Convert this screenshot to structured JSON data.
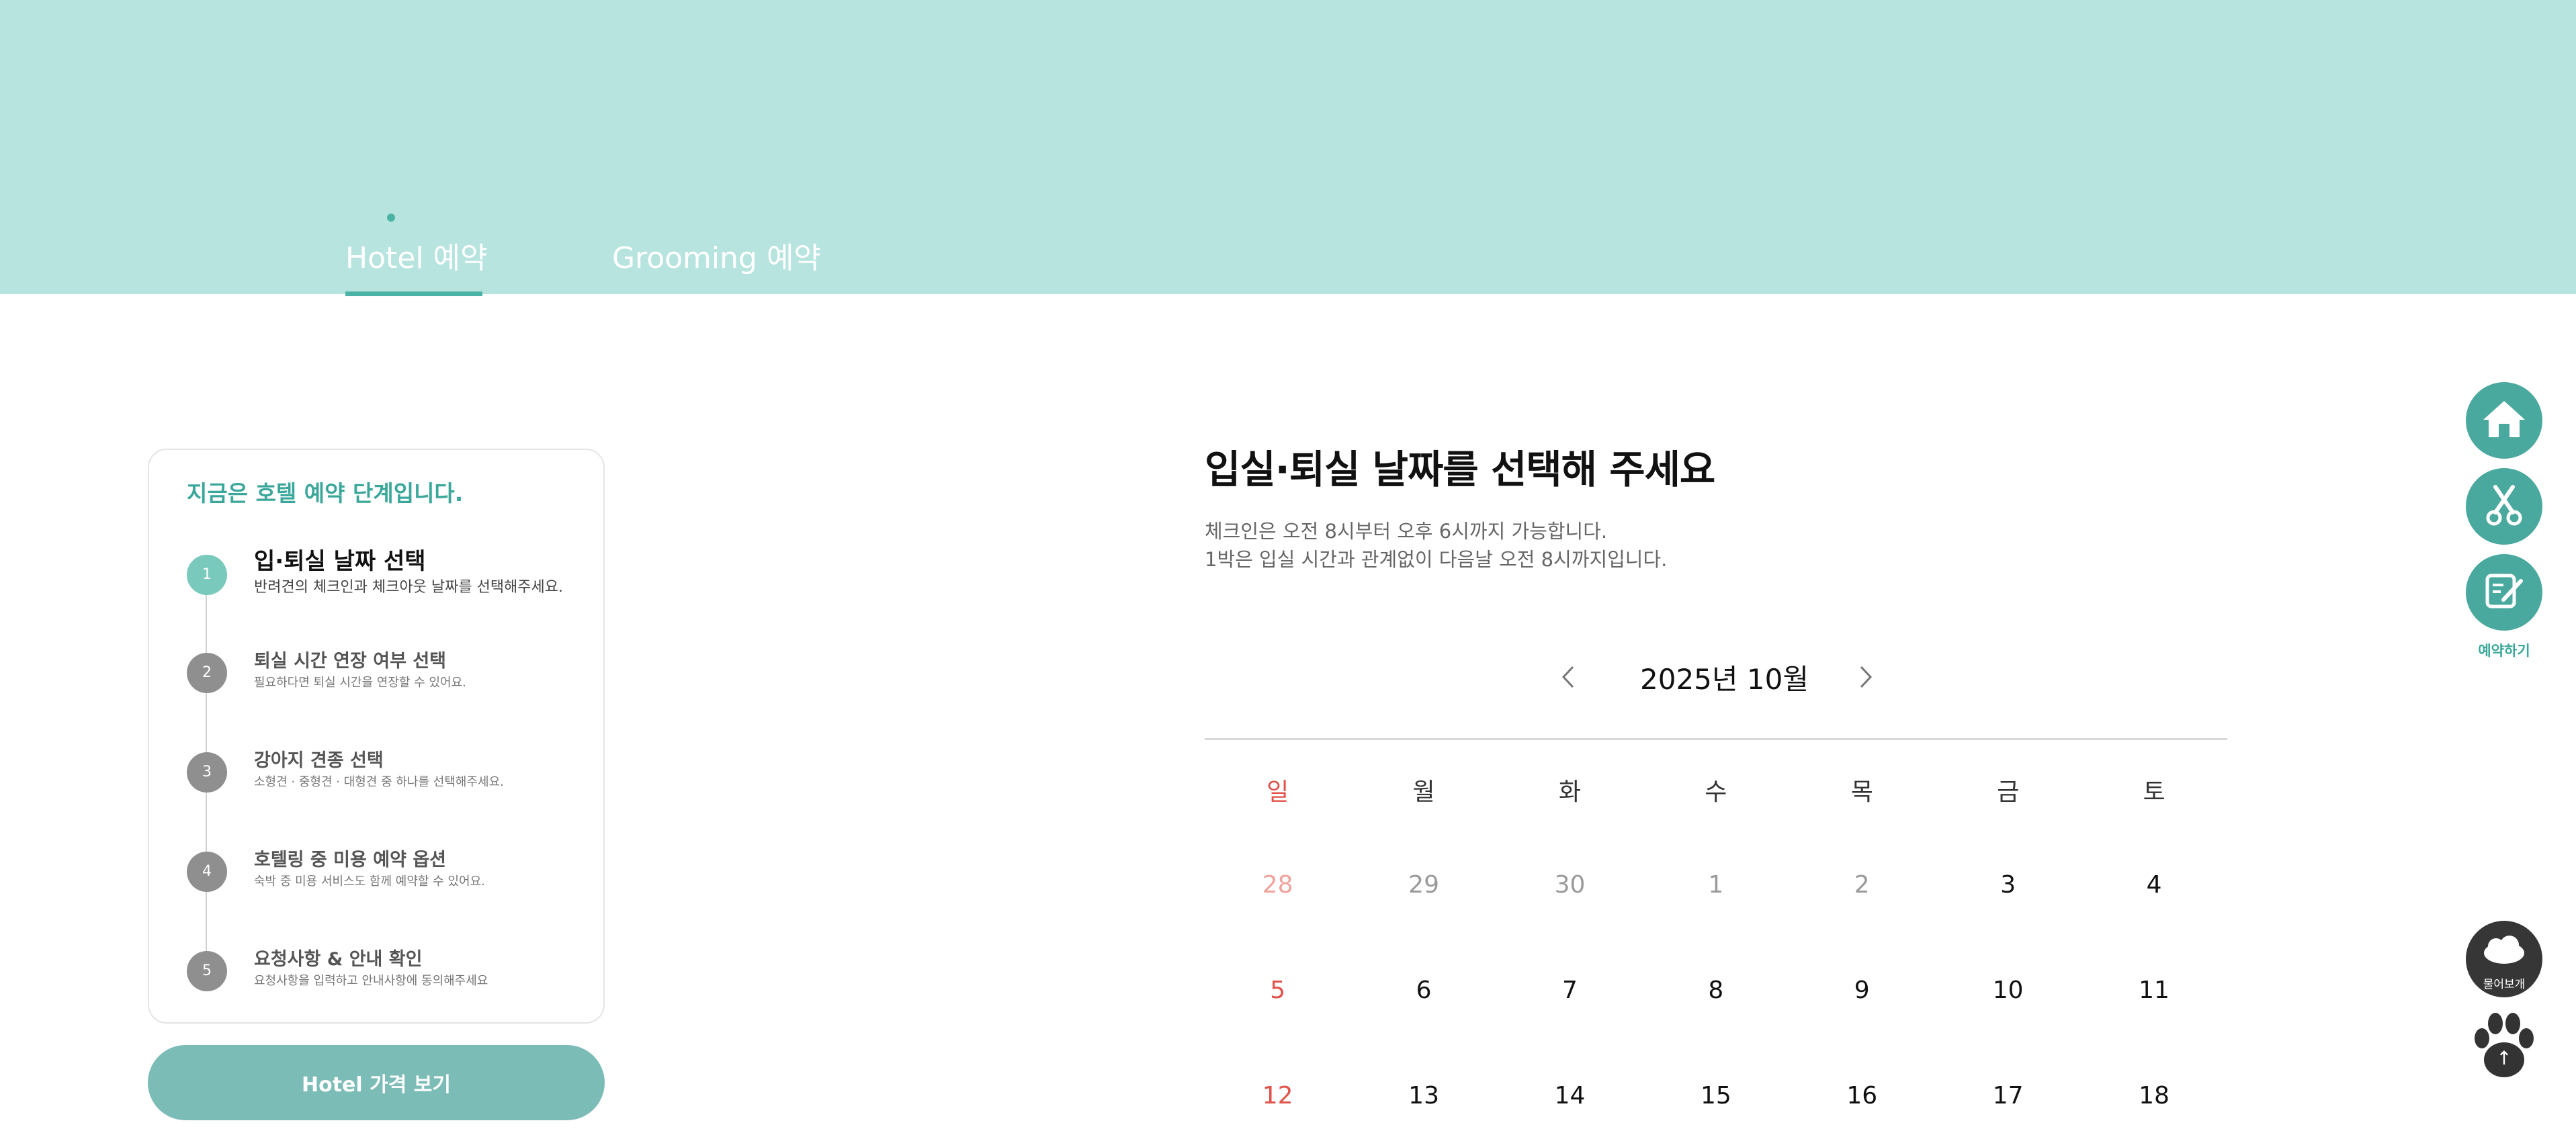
{
  "header": {
    "tabs": [
      {
        "label": "Hotel 예약",
        "active": true
      },
      {
        "label": "Grooming 예약",
        "active": false
      }
    ]
  },
  "steps_panel": {
    "headline": "지금은 호텔 예약 단계입니다.",
    "steps": [
      {
        "number": "1",
        "title": "입·퇴실 날짜 선택",
        "description": "반려견의 체크인과 체크아웃 날짜를 선택해주세요.",
        "active": true
      },
      {
        "number": "2",
        "title": "퇴실 시간 연장 여부 선택",
        "description": "필요하다면 퇴실 시간을 연장할 수 있어요.",
        "active": false
      },
      {
        "number": "3",
        "title": "강아지 견종 선택",
        "description": "소형견 · 중형견 · 대형견 중 하나를 선택해주세요.",
        "active": false
      },
      {
        "number": "4",
        "title": "호텔링 중 미용 예약 옵션",
        "description": "숙박 중 미용 서비스도 함께 예약할 수 있어요.",
        "active": false
      },
      {
        "number": "5",
        "title": "요청사항 & 안내 확인",
        "description": "요청사항을 입력하고 안내사항에 동의해주세요",
        "active": false
      }
    ],
    "price_button": "Hotel 가격 보기"
  },
  "main": {
    "title": "입실·퇴실 날짜를 선택해 주세요",
    "info_lines": [
      "체크인은 오전 8시부터 오후 6시까지 가능합니다.",
      "1박은 입실 시간과 관계없이 다음날 오전 8시까지입니다."
    ],
    "calendar": {
      "month_label": "2025년 10월",
      "prev_icon": "chevron-left-icon",
      "next_icon": "chevron-right-icon",
      "weekdays": [
        "일",
        "월",
        "화",
        "수",
        "목",
        "금",
        "토"
      ],
      "weeks": [
        [
          {
            "day": "28",
            "muted": true
          },
          {
            "day": "29",
            "muted": true
          },
          {
            "day": "30",
            "muted": true
          },
          {
            "day": "1",
            "muted": true
          },
          {
            "day": "2",
            "muted": true
          },
          {
            "day": "3",
            "muted": false
          },
          {
            "day": "4",
            "muted": false
          }
        ],
        [
          {
            "day": "5",
            "muted": false
          },
          {
            "day": "6",
            "muted": false
          },
          {
            "day": "7",
            "muted": false
          },
          {
            "day": "8",
            "muted": false
          },
          {
            "day": "9",
            "muted": false
          },
          {
            "day": "10",
            "muted": false
          },
          {
            "day": "11",
            "muted": false
          }
        ],
        [
          {
            "day": "12",
            "muted": false
          },
          {
            "day": "13",
            "muted": false
          },
          {
            "day": "14",
            "muted": false
          },
          {
            "day": "15",
            "muted": false
          },
          {
            "day": "16",
            "muted": false
          },
          {
            "day": "17",
            "muted": false
          },
          {
            "day": "18",
            "muted": false
          }
        ]
      ]
    }
  },
  "quick_menu": {
    "items": [
      {
        "icon": "home-icon"
      },
      {
        "icon": "scissors-icon"
      },
      {
        "icon": "edit-icon"
      }
    ],
    "reserve_label": "예약하기",
    "ask_label": "물어보개",
    "ask_icon": "cloud-icon",
    "top_icon": "paw-icon"
  },
  "colors": {
    "banner": "#b7e4de",
    "accent": "#4aa99e",
    "price_button": "#7bbcb6",
    "sunday": "#e0524a"
  }
}
